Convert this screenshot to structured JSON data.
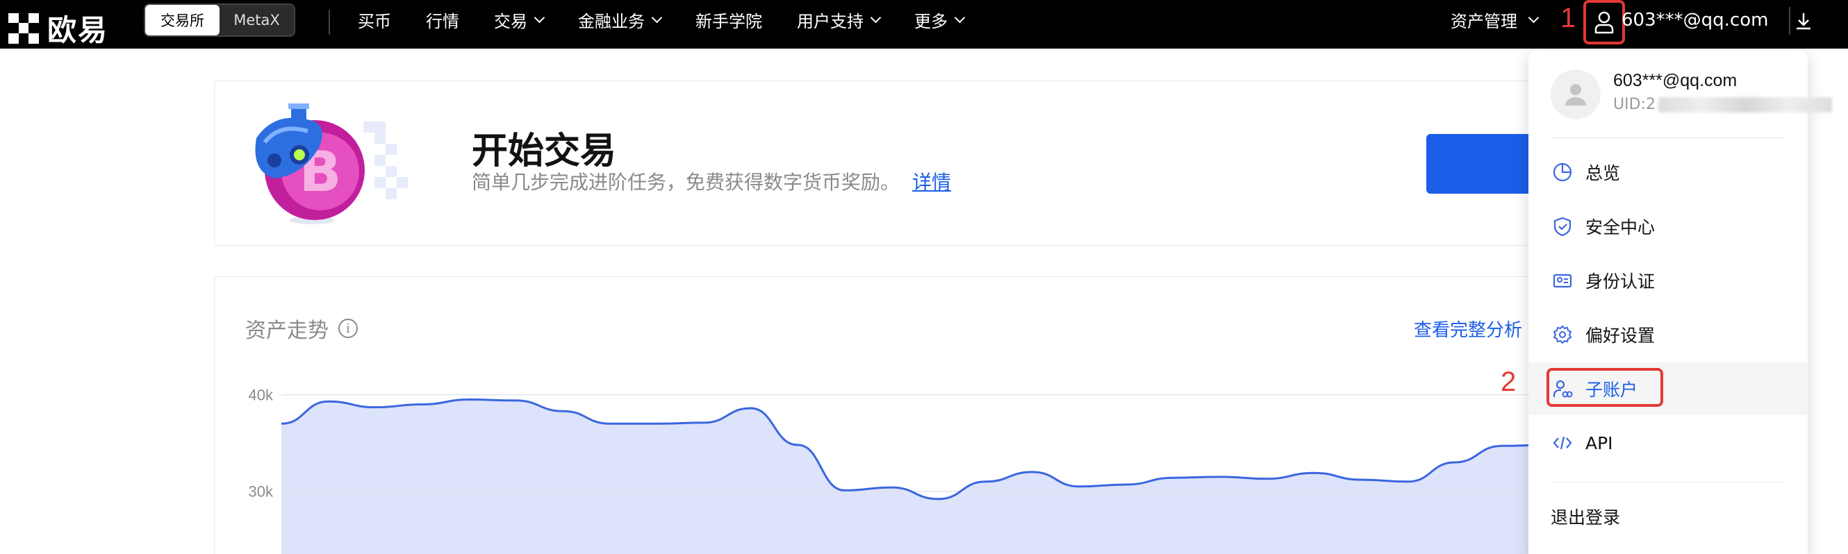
{
  "topbar": {
    "logo_text": "欧易",
    "segment": [
      "交易所",
      "MetaX"
    ],
    "nav": [
      {
        "label": "买币",
        "dropdown": false
      },
      {
        "label": "行情",
        "dropdown": false
      },
      {
        "label": "交易",
        "dropdown": true
      },
      {
        "label": "金融业务",
        "dropdown": true
      },
      {
        "label": "新手学院",
        "dropdown": false
      },
      {
        "label": "用户支持",
        "dropdown": true
      },
      {
        "label": "更多",
        "dropdown": true
      }
    ],
    "asset_mgmt": "资产管理",
    "email": "603***@qq.com",
    "annotation_1": "1",
    "annotation_2": "2"
  },
  "promo": {
    "title": "开始交易",
    "desc": "简单几步完成进阶任务，免费获得数字货币奖励。",
    "link": "详情"
  },
  "trend": {
    "title": "资产走势",
    "link": "查看完整分析",
    "info_glyph": "i"
  },
  "chart_data": {
    "type": "area",
    "ytick_labels": [
      "40k",
      "30k"
    ],
    "yticks": [
      40000,
      30000
    ],
    "y": [
      37000,
      39300,
      38700,
      39000,
      39500,
      39400,
      38300,
      37000,
      37000,
      37100,
      38600,
      34800,
      30100,
      30400,
      29200,
      31000,
      32000,
      30500,
      30700,
      31400,
      31500,
      31300,
      31900,
      31200,
      31000,
      33000,
      34700,
      34800
    ],
    "ylim": [
      22000,
      45000
    ],
    "grid": true,
    "color": "#3a66e0",
    "fill": "#dde3fa"
  },
  "dropdown": {
    "email": "603***@qq.com",
    "uid_prefix": "UID:2",
    "items": [
      {
        "label": "总览",
        "icon": "pie-chart-icon"
      },
      {
        "label": "安全中心",
        "icon": "shield-icon"
      },
      {
        "label": "身份认证",
        "icon": "id-card-icon"
      },
      {
        "label": "偏好设置",
        "icon": "gear-icon"
      },
      {
        "label": "子账户",
        "icon": "sub-account-icon"
      },
      {
        "label": "API",
        "icon": "code-icon"
      }
    ],
    "logout": "退出登录"
  }
}
